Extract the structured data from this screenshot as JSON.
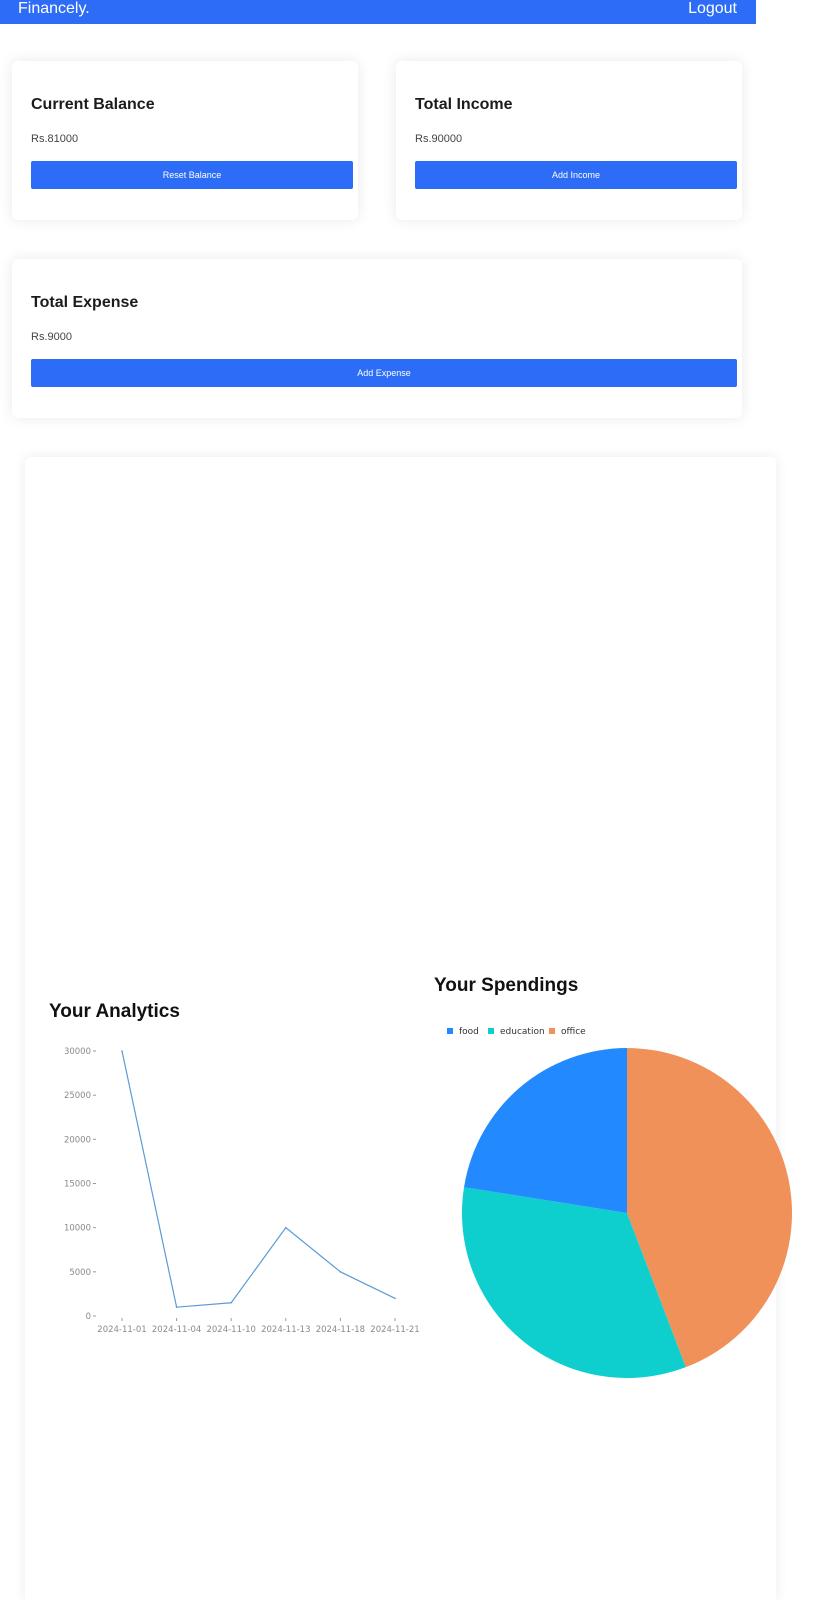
{
  "navbar": {
    "brand": "Financely.",
    "logout_label": "Logout",
    "color": "#2c6cf6"
  },
  "cards": {
    "balance": {
      "title": "Current Balance",
      "amount": "Rs.81000",
      "button": "Reset Balance"
    },
    "income": {
      "title": "Total Income",
      "amount": "Rs.90000",
      "button": "Add Income"
    },
    "expense": {
      "title": "Total Expense",
      "amount": "Rs.9000",
      "button": "Add Expense"
    }
  },
  "analytics": {
    "title": "Your Analytics"
  },
  "spendings": {
    "title": "Your Spendings"
  },
  "chart_data": [
    {
      "type": "line",
      "x": [
        "2024-11-01",
        "2024-11-04",
        "2024-11-10",
        "2024-11-13",
        "2024-11-18",
        "2024-11-21"
      ],
      "y": [
        30000,
        1000,
        1500,
        10000,
        5000,
        2000
      ],
      "yticks": [
        0,
        5000,
        10000,
        15000,
        20000,
        25000,
        30000
      ],
      "ylim": [
        0,
        30000
      ],
      "color": "#5b9bd5",
      "grid": false
    },
    {
      "type": "pie",
      "labels": [
        "food",
        "education",
        "office"
      ],
      "values": [
        22.5,
        33.3,
        44.2
      ],
      "colors": [
        "#2389ff",
        "#0fcece",
        "#f0915a"
      ],
      "legend": "top"
    }
  ]
}
